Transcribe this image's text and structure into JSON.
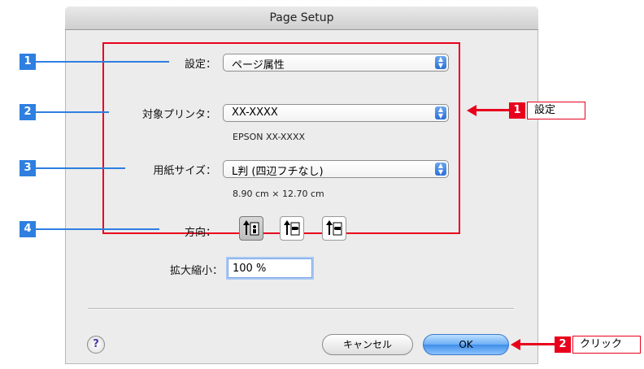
{
  "dialog": {
    "title": "Page Setup"
  },
  "settings": {
    "label": "設定：",
    "value": "ページ属性"
  },
  "printer": {
    "label": "対象プリンタ：",
    "value": "XX-XXXX",
    "info": "EPSON XX-XXXX"
  },
  "paper": {
    "label": "用紙サイズ：",
    "value": "L判 (四辺フチなし)",
    "info": "8.90 cm × 12.70 cm"
  },
  "orientation": {
    "label": "方向：",
    "selected": "portrait"
  },
  "scale": {
    "label": "拡大縮小：",
    "value": "100 %"
  },
  "buttons": {
    "help": "?",
    "cancel": "キャンセル",
    "ok": "OK"
  },
  "markers": [
    "1",
    "2",
    "3",
    "4"
  ],
  "callouts": [
    {
      "number": "1",
      "label": "設定"
    },
    {
      "number": "2",
      "label": "クリック"
    }
  ],
  "colors": {
    "highlight": "#e8001c",
    "marker": "#2e7fe0",
    "ok_button": "#6aaef5"
  }
}
